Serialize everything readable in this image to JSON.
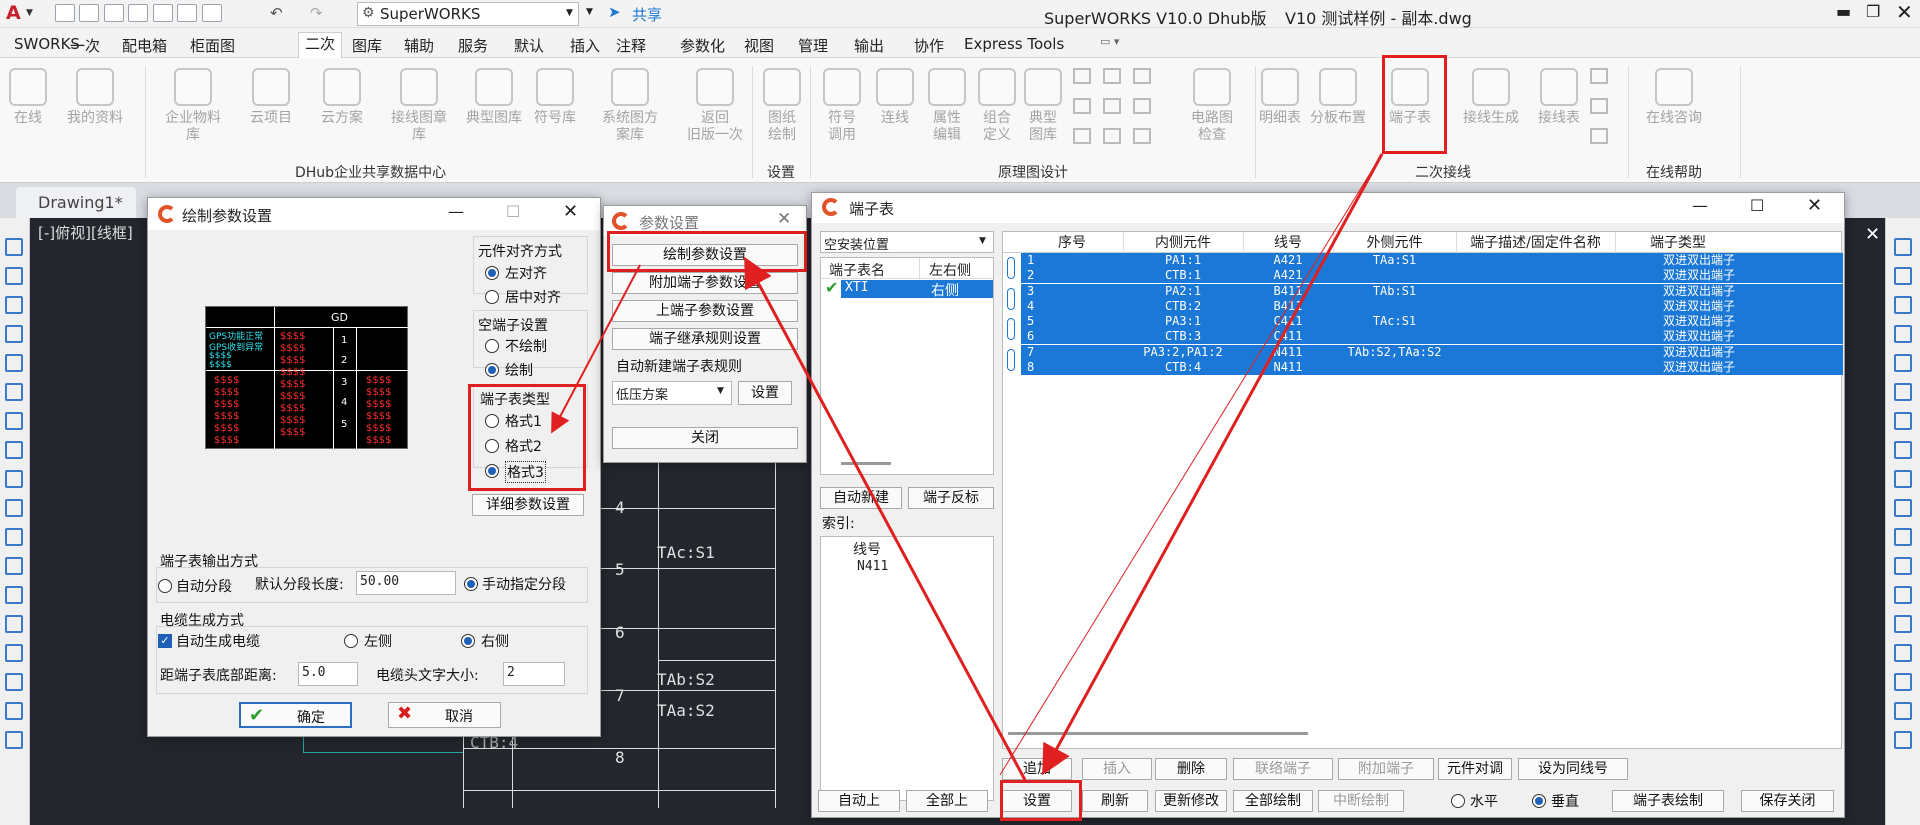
{
  "app": {
    "title": "SuperWORKS V10.0 Dhub版",
    "document_title": "V10 测试样例 - 副本.dwg",
    "workspace": "SuperWORKS",
    "share": "共享"
  },
  "menu_tabs": [
    "SWORKS",
    "一次",
    "配电箱",
    "柜面图",
    "二次",
    "图库",
    "辅助",
    "服务",
    "默认",
    "插入",
    "注释",
    "参数化",
    "视图",
    "管理",
    "输出",
    "协作",
    "Express Tools"
  ],
  "ribbon": {
    "items": [
      {
        "label": "在线",
        "sub": ""
      },
      {
        "label": "我的资料",
        "sub": ""
      },
      {
        "label": "企业物料库",
        "sub": ""
      },
      {
        "label": "云项目",
        "sub": ""
      },
      {
        "label": "云方案",
        "sub": ""
      },
      {
        "label": "接线图章库",
        "sub": ""
      },
      {
        "label": "典型图库",
        "sub": ""
      },
      {
        "label": "符号库",
        "sub": ""
      },
      {
        "label": "系统图方案库",
        "sub": ""
      },
      {
        "label": "返回",
        "sub": "旧版一次"
      },
      {
        "label": "图纸",
        "sub": "绘制"
      },
      {
        "label": "符号",
        "sub": "调用"
      },
      {
        "label": "连线",
        "sub": ""
      },
      {
        "label": "属性",
        "sub": "编辑"
      },
      {
        "label": "组合",
        "sub": "定义"
      },
      {
        "label": "典型",
        "sub": "图库"
      },
      {
        "label": "电路图",
        "sub": "检查"
      },
      {
        "label": "明细表",
        "sub": ""
      },
      {
        "label": "分板布置",
        "sub": ""
      },
      {
        "label": "端子表",
        "sub": ""
      },
      {
        "label": "接线生成",
        "sub": ""
      },
      {
        "label": "接线表",
        "sub": ""
      },
      {
        "label": "在线咨询",
        "sub": ""
      }
    ],
    "groups": [
      "DHub企业共享数据中心",
      "设置",
      "原理图设计",
      "二次接线",
      "在线帮助"
    ]
  },
  "doc_tabs": [
    "Drawing1*"
  ],
  "viewport_label": "[-]俯视][线框]",
  "cad": {
    "numbers": [
      "4",
      "5",
      "6",
      "7",
      "8"
    ],
    "labels": [
      "TAc:S1",
      "TAb:S2",
      "TAa:S2",
      "CTB:4"
    ]
  },
  "draw_dialog": {
    "title": "绘制参数设置",
    "align": {
      "title": "元件对齐方式",
      "options": [
        "左对齐",
        "居中对齐"
      ],
      "selected": 0
    },
    "empty": {
      "title": "空端子设置",
      "options": [
        "不绘制",
        "绘制"
      ],
      "selected": 1
    },
    "type": {
      "title": "端子表类型",
      "options": [
        "格式1",
        "格式2",
        "格式3"
      ],
      "selected": 2
    },
    "detail_btn": "详细参数设置",
    "preview": {
      "header": "GD",
      "rows": [
        "GPS功能正常",
        "GPS收到异常",
        "$$$$",
        "$$$$"
      ],
      "nums": [
        "1",
        "2",
        "3",
        "4",
        "5"
      ]
    },
    "output": {
      "title": "端子表输出方式",
      "auto": "自动分段",
      "seglen_label": "默认分段长度:",
      "seglen": "50.00",
      "manual": "手动指定分段",
      "selected": 1
    },
    "cable": {
      "title": "电缆生成方式",
      "auto": "自动生成电缆",
      "left": "左侧",
      "right": "右侧",
      "selected": 1,
      "dist_label": "距端子表底部距离:",
      "dist": "5.0",
      "size_label": "电缆头文字大小:",
      "size": "2"
    },
    "ok": "确定",
    "cancel": "取消"
  },
  "param_dialog": {
    "title": "参数设置",
    "buttons": [
      "绘制参数设置",
      "附加端子参数设置",
      "上端子参数设置",
      "端子继承规则设置"
    ],
    "rule_label": "自动新建端子表规则",
    "rule_value": "低压方案",
    "rule_btn": "设置",
    "close": "关闭"
  },
  "terminal": {
    "title": "端子表",
    "location": "空安装位置",
    "list_headers": [
      "端子表名",
      "左右侧"
    ],
    "list_rows": [
      {
        "name": "XTI",
        "side": "右侧"
      }
    ],
    "btn_auto_new": "自动新建",
    "btn_reverse": "端子反标",
    "index_label": "索引:",
    "index_header": "线号",
    "index_value": "N411",
    "columns": [
      "序号",
      "内侧元件",
      "线号",
      "外侧元件",
      "端子描述/固定件名称",
      "端子类型"
    ],
    "rows": [
      [
        "1",
        "PA1:1",
        "A421",
        "TAa:S1",
        "",
        "双进双出端子"
      ],
      [
        "2",
        "CTB:1",
        "A421",
        "",
        "",
        "双进双出端子"
      ],
      [
        "3",
        "PA2:1",
        "B411",
        "TAb:S1",
        "",
        "双进双出端子"
      ],
      [
        "4",
        "CTB:2",
        "B411",
        "",
        "",
        "双进双出端子"
      ],
      [
        "5",
        "PA3:1",
        "C411",
        "TAc:S1",
        "",
        "双进双出端子"
      ],
      [
        "6",
        "CTB:3",
        "C411",
        "",
        "",
        "双进双出端子"
      ],
      [
        "7",
        "PA3:2,PA1:2",
        "N411",
        "TAb:S2,TAa:S2",
        "",
        "双进双出端子"
      ],
      [
        "8",
        "CTB:4",
        "N411",
        "",
        "",
        "双进双出端子"
      ]
    ],
    "row1_buttons": [
      "追加",
      "插入",
      "删除",
      "联络端子",
      "附加端子",
      "元件对调",
      "设为同线号"
    ],
    "row2_buttons": [
      "自动上",
      "全部上",
      "设置",
      "刷新",
      "更新修改",
      "全部绘制",
      "中断绘制"
    ],
    "orient": {
      "h": "水平",
      "v": "垂直",
      "selected": 1
    },
    "draw_btn": "端子表绘制",
    "save_btn": "保存关闭"
  },
  "colors": {
    "accent": "#1c78d6",
    "highlight": "#e02020",
    "logo": "#e2532a"
  }
}
